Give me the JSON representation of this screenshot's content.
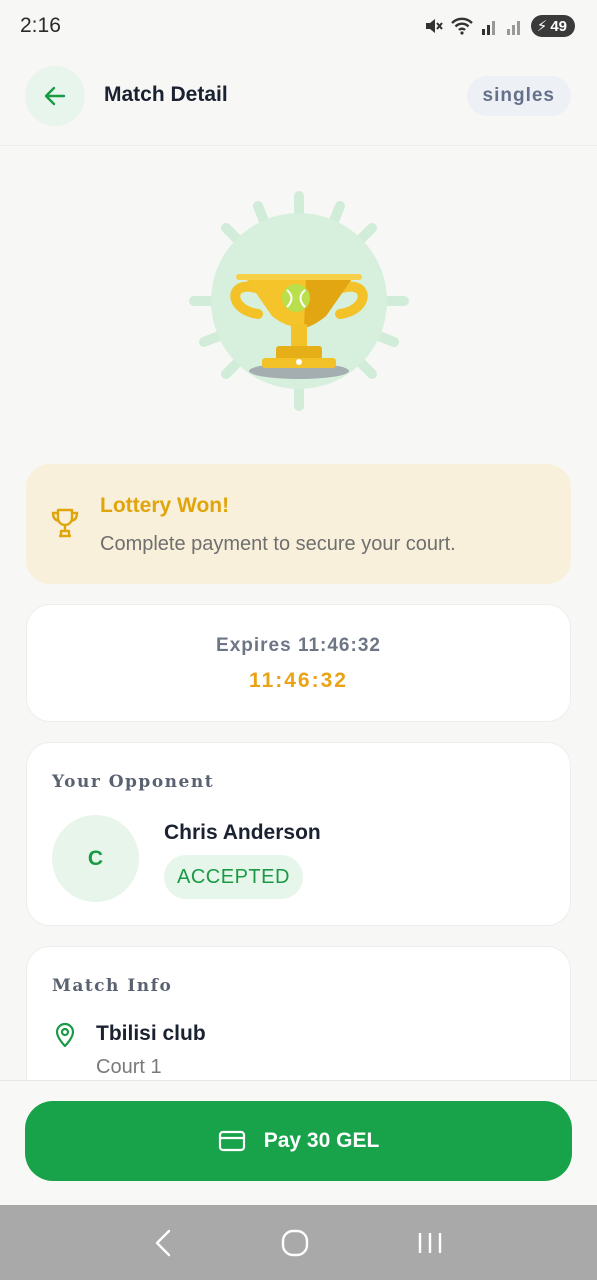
{
  "status_bar": {
    "time": "2:16",
    "battery": "49"
  },
  "header": {
    "title": "Match Detail",
    "match_type": "singles"
  },
  "lottery": {
    "title": "Lottery Won!",
    "message": "Complete payment to secure your court."
  },
  "expiry": {
    "label": "Expires 11:46:32",
    "timer": "11:46:32"
  },
  "opponent": {
    "section_label": "Your Opponent",
    "initial": "C",
    "name": "Chris Anderson",
    "status": "ACCEPTED"
  },
  "match_info": {
    "section_label": "Match Info",
    "club": "Tbilisi club",
    "court": "Court 1"
  },
  "payment": {
    "button_label": "Pay 30 GEL"
  },
  "colors": {
    "primary_green": "#18a24a",
    "gold": "#e0a50b",
    "timer_orange": "#eba316",
    "lottery_bg": "#f8f0da"
  },
  "icons": [
    "back-arrow-icon",
    "trophy-illustration",
    "trophy-icon",
    "location-pin-icon",
    "credit-card-icon",
    "nav-back-icon",
    "nav-home-icon",
    "nav-recents-icon"
  ]
}
